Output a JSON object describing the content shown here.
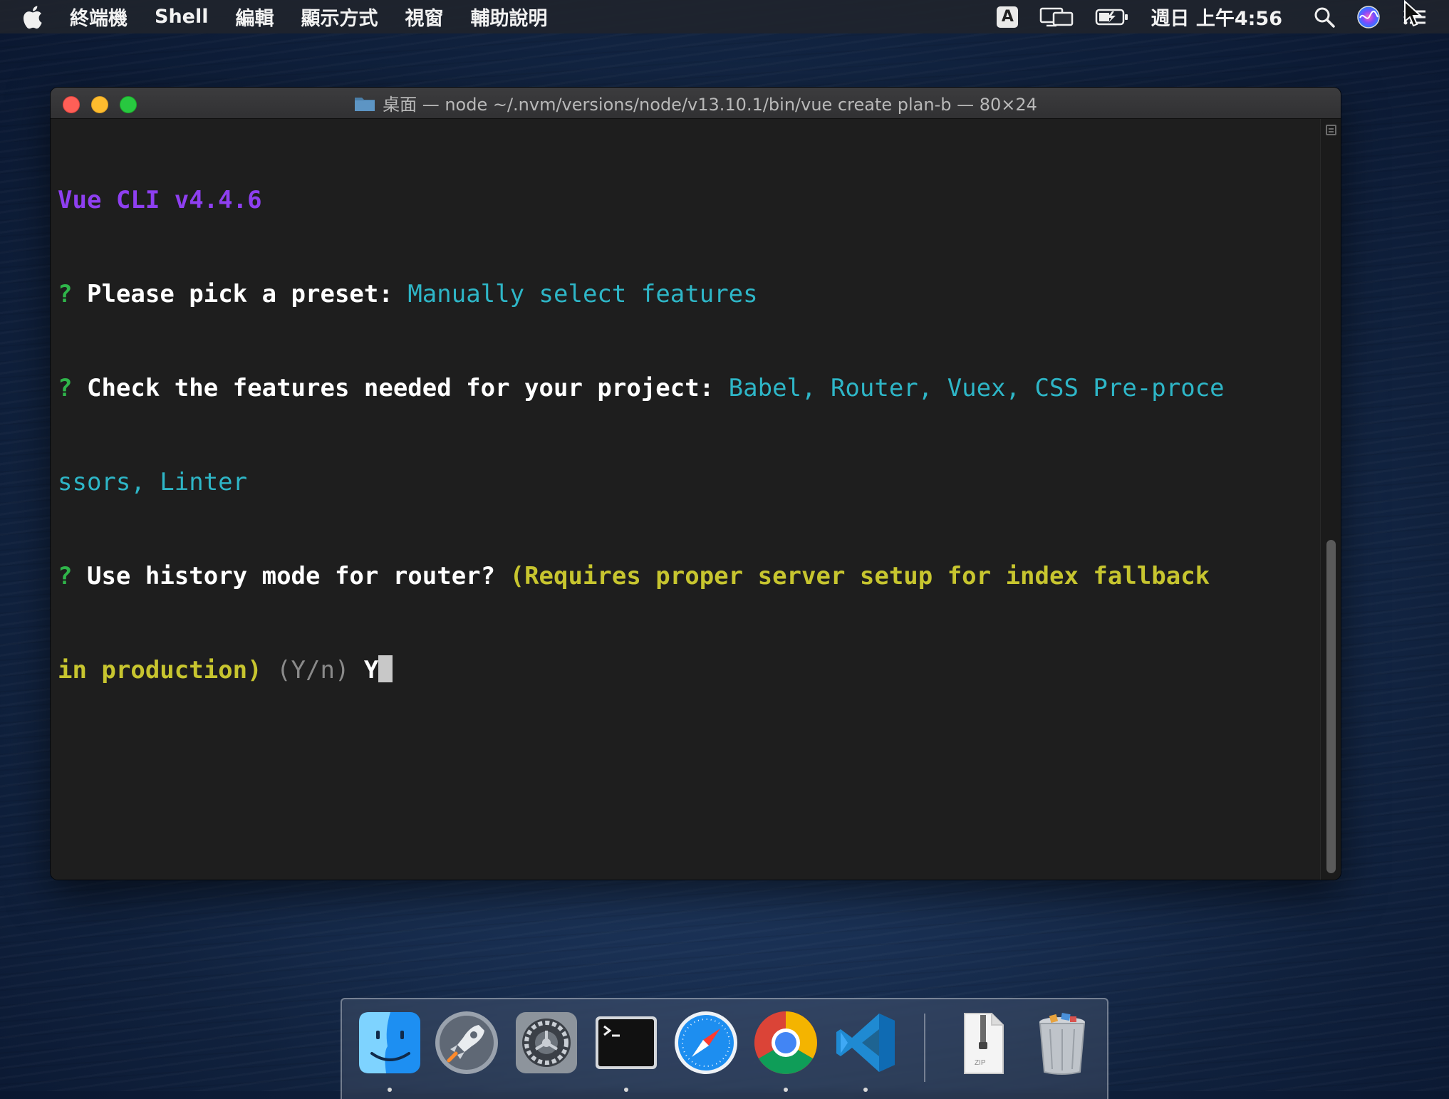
{
  "menubar": {
    "app_name": "終端機",
    "menus": [
      "Shell",
      "編輯",
      "顯示方式",
      "視窗",
      "輔助說明"
    ],
    "input_method": "A",
    "clock": "週日 上午4:56",
    "icons": [
      "apple-icon",
      "input-method-icon",
      "display-mirror-icon",
      "battery-icon",
      "spotlight-search-icon",
      "siri-icon",
      "control-strip-icon"
    ]
  },
  "window": {
    "title": "桌面 — node ~/.nvm/versions/node/v13.10.1/bin/vue create plan-b — 80×24"
  },
  "terminal": {
    "cli_version": "Vue CLI v4.4.6",
    "q1_mark": "?",
    "q1_prompt": "Please pick a preset:",
    "q1_answer": "Manually select features",
    "q2_mark": "?",
    "q2_prompt": "Check the features needed for your project:",
    "q2_answer_line1": "Babel, Router, Vuex, CSS Pre-proce",
    "q2_answer_line2": "ssors, Linter",
    "q3_mark": "?",
    "q3_prompt": "Use history mode for router?",
    "q3_hint_line1": "(Requires proper server setup for index fallback",
    "q3_hint_line2": "in production)",
    "q3_choices": "(Y/n)",
    "q3_input": "Y"
  },
  "dock": {
    "apps": [
      "finder-icon",
      "launchpad-icon",
      "system-preferences-icon",
      "terminal-icon",
      "safari-icon",
      "chrome-icon",
      "vscode-icon",
      "zip-archive-icon",
      "trash-icon"
    ],
    "zip_label": "ZIP"
  },
  "colors": {
    "purple": "#8e3ff0",
    "green": "#2fb54a",
    "cyan": "#2eb6c7",
    "yellow": "#c7c52f",
    "terminal_bg": "#1e1e1e"
  }
}
